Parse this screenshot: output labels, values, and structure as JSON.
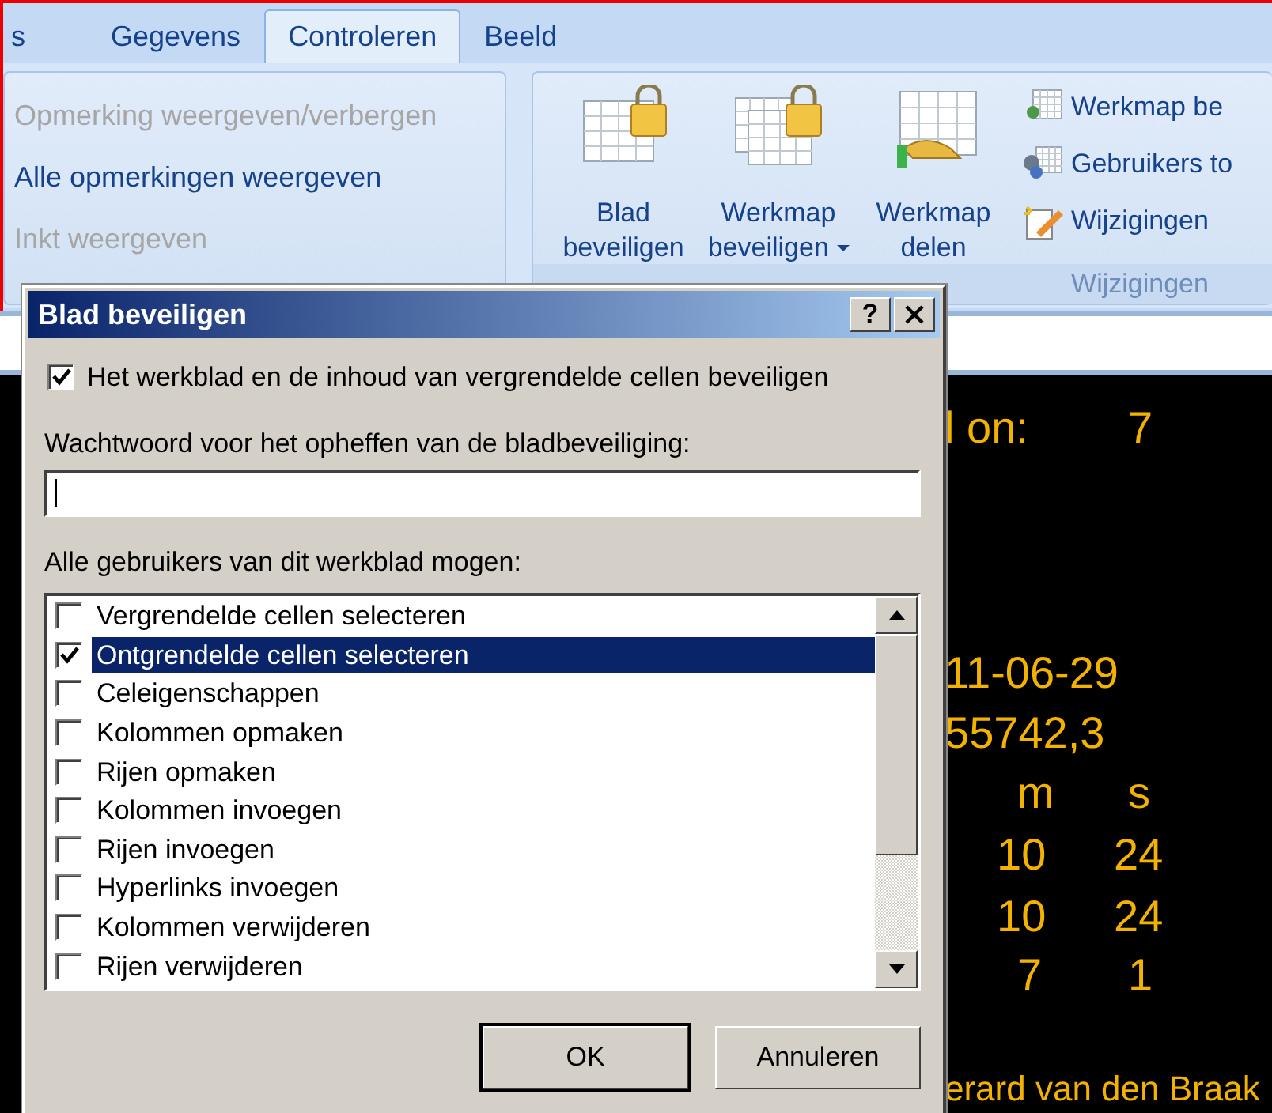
{
  "ribbon": {
    "tabs": [
      {
        "label": "s",
        "selected": false
      },
      {
        "label": "Gegevens",
        "selected": false
      },
      {
        "label": "Controleren",
        "selected": true
      },
      {
        "label": "Beeld",
        "selected": false
      }
    ],
    "comment_commands": [
      {
        "label": "Opmerking weergeven/verbergen",
        "disabled": true
      },
      {
        "label": "Alle opmerkingen weergeven",
        "disabled": false
      },
      {
        "label": "Inkt weergeven",
        "disabled": true
      }
    ],
    "large_buttons": [
      {
        "kind": "sheet-lock",
        "lines": [
          "Blad",
          "beveiligen"
        ],
        "dropdown": false
      },
      {
        "kind": "workbook-lock",
        "lines": [
          "Werkmap",
          "beveiligen"
        ],
        "dropdown": true
      },
      {
        "kind": "share",
        "lines": [
          "Werkmap",
          "delen"
        ],
        "dropdown": false
      }
    ],
    "small_buttons": [
      {
        "kind": "workbook-user",
        "label": "Werkmap be"
      },
      {
        "kind": "users",
        "label": "Gebruikers to"
      },
      {
        "kind": "changes",
        "label": "Wijzigingen"
      }
    ],
    "group_label": "Wijzigingen"
  },
  "sheet": {
    "rows": [
      [
        "l on:",
        "7"
      ],
      [
        "11-06-29"
      ],
      [
        "55742,3"
      ],
      [
        "m",
        "s"
      ],
      [
        "10",
        "24"
      ],
      [
        "10",
        "24"
      ],
      [
        "7",
        "1"
      ],
      [
        "erard van den Braak"
      ]
    ]
  },
  "dialog": {
    "title": "Blad beveiligen",
    "help": "?",
    "protect": {
      "label": "Het werkblad en de inhoud van vergrendelde cellen beveiligen",
      "checked": true
    },
    "password_label": "Wachtwoord voor het opheffen van de bladbeveiliging:",
    "permissions_label": "Alle gebruikers van dit werkblad mogen:",
    "permissions": [
      {
        "label": "Vergrendelde cellen selecteren",
        "checked": false,
        "selected": false
      },
      {
        "label": "Ontgrendelde cellen selecteren",
        "checked": true,
        "selected": true
      },
      {
        "label": "Celeigenschappen",
        "checked": false,
        "selected": false
      },
      {
        "label": "Kolommen opmaken",
        "checked": false,
        "selected": false
      },
      {
        "label": "Rijen opmaken",
        "checked": false,
        "selected": false
      },
      {
        "label": "Kolommen invoegen",
        "checked": false,
        "selected": false
      },
      {
        "label": "Rijen invoegen",
        "checked": false,
        "selected": false
      },
      {
        "label": "Hyperlinks invoegen",
        "checked": false,
        "selected": false
      },
      {
        "label": "Kolommen verwijderen",
        "checked": false,
        "selected": false
      },
      {
        "label": "Rijen verwijderen",
        "checked": false,
        "selected": false
      }
    ],
    "buttons": [
      {
        "label": "OK",
        "default": true
      },
      {
        "label": "Annuleren",
        "default": false
      }
    ]
  }
}
